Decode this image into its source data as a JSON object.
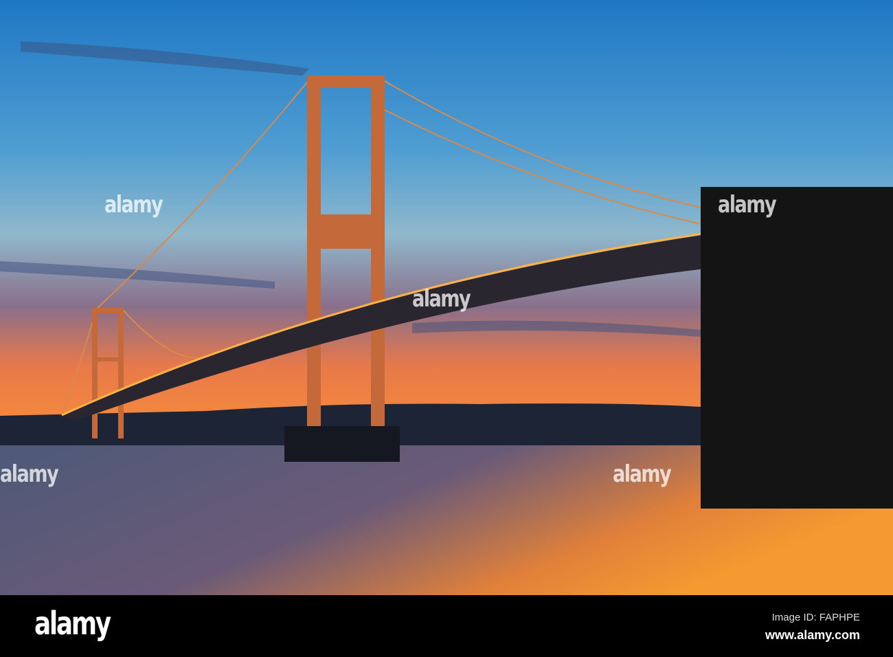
{
  "watermark": {
    "text": "alamy"
  },
  "footer": {
    "logo": "alamy",
    "image_id": "Image ID: FAPHPE",
    "site": "www.alamy.com"
  },
  "colors": {
    "sky_top": "#1f78c4",
    "horizon": "#f07a3a",
    "water": "#4a5470",
    "lights": "#ffb347"
  }
}
